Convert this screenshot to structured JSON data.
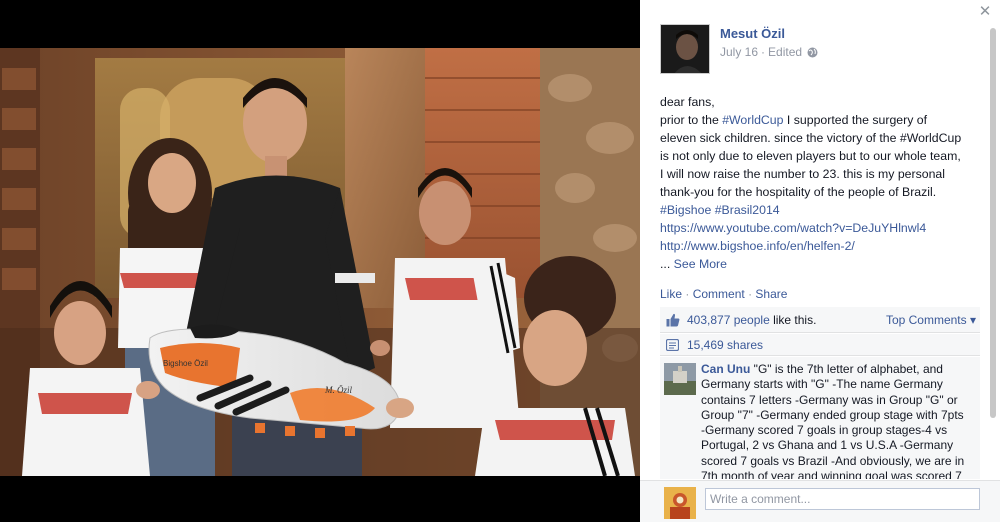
{
  "photo": {
    "boot_text": "Bigshoe Özil",
    "boot_signature": "M. Özil"
  },
  "post": {
    "author": "Mesut Özil",
    "date": "July 16",
    "separator": "·",
    "edited": "Edited",
    "lines": [
      {
        "text": "dear fans,"
      },
      {
        "pre": "prior to the ",
        "link": "#WorldCup",
        "post": " I supported the surgery of"
      },
      {
        "text": "eleven sick children. since the victory of the #WorldCup"
      },
      {
        "text": "is not only due to eleven players but to our whole team,"
      },
      {
        "text": "I will now raise the number to 23. this is my personal"
      },
      {
        "text": "thank-you for the hospitality of the people of Brazil."
      },
      {
        "link": "#Bigshoe #Brasil2014"
      },
      {
        "link": "https://www.youtube.com/watch?v=DeJuYHlnwl4"
      },
      {
        "link": "http://www.bigshoe.info/en/helfen-2/"
      }
    ],
    "ellipsis": "...",
    "see_more": "See More"
  },
  "actions": {
    "like": "Like",
    "comment": "Comment",
    "share": "Share",
    "sep": "·"
  },
  "likes": {
    "count": "403,877 people",
    "suffix": " like this.",
    "top_comments": "Top Comments ▾"
  },
  "shares": {
    "count": "15,469 shares"
  },
  "comment": {
    "author": "Can Unu",
    "lines": [
      " \"G\" is the 7th letter of alphabet, and",
      "Germany starts with \"G\" -The name Germany",
      "contains 7 letters -Germany was in Group \"G\" or",
      "Group \"7\" -Germany ended group stage with 7pts",
      "-Germany scored 7 goals in group stages-4 vs",
      "Portugal, 2 vs Ghana and 1 vs U.S.A -Germany",
      "scored 7 goals vs Brazil -And obviously, we are in",
      "7th month of year and winning goal was scored 7"
    ]
  },
  "composer": {
    "placeholder": "Write a comment..."
  },
  "colors": {
    "link": "#3b5998",
    "meta": "#9197a3",
    "panel_bg": "#ffffff",
    "box_bg": "#f6f7f8"
  }
}
